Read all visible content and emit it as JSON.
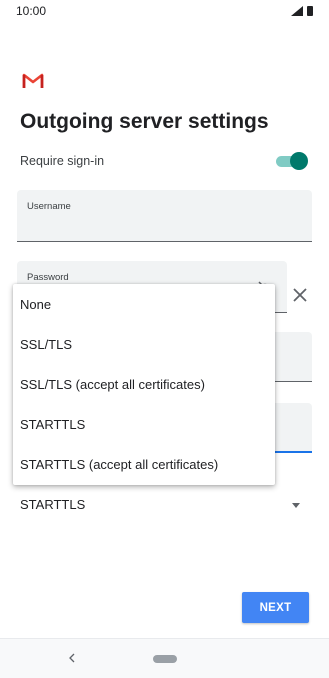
{
  "status_bar": {
    "time": "10:00"
  },
  "page": {
    "title": "Outgoing server settings"
  },
  "require_signin": {
    "label": "Require sign-in",
    "enabled": true
  },
  "username": {
    "label": "Username"
  },
  "password": {
    "label": "Password"
  },
  "security": {
    "selected": "STARTTLS"
  },
  "menu": {
    "items": [
      "None",
      "SSL/TLS",
      "SSL/TLS (accept all certificates)",
      "STARTTLS",
      "STARTTLS (accept all certificates)"
    ]
  },
  "actions": {
    "next_label": "NEXT"
  },
  "colors": {
    "accent": "#4285f4",
    "toggle": "#00796b",
    "brand": "#ea4335"
  },
  "icons": [
    "gmail-logo-icon",
    "signal-icon",
    "battery-icon",
    "close-icon",
    "eye-icon",
    "dropdown-arrow-icon",
    "back-icon",
    "home-icon"
  ]
}
